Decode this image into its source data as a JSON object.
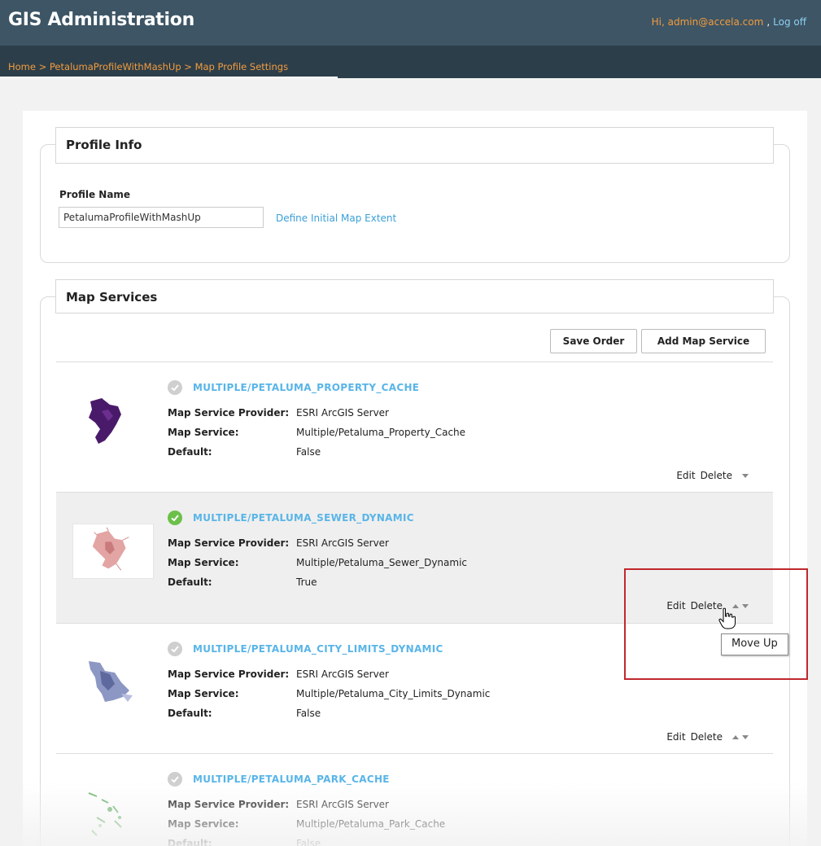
{
  "app": {
    "title": "GIS Administration"
  },
  "user": {
    "greeting": "Hi, admin@accela.com",
    "separator": ",",
    "logoff": "Log off"
  },
  "breadcrumb": "Home > PetalumaProfileWithMashUp > Map Profile Settings",
  "profile_info": {
    "heading": "Profile Info",
    "name_label": "Profile Name",
    "name_value": "PetalumaProfileWithMashUp",
    "extent_link": "Define Initial Map Extent"
  },
  "map_services": {
    "heading": "Map Services",
    "save_order": "Save Order",
    "add_service": "Add Map Service",
    "labels": {
      "provider": "Map Service Provider:",
      "service": "Map Service:",
      "default": "Default:"
    },
    "actions": {
      "edit": "Edit",
      "delete": "Delete"
    },
    "items": [
      {
        "name": "MULTIPLE/PETALUMA_PROPERTY_CACHE",
        "provider": "ESRI ArcGIS Server",
        "service": "Multiple/Petaluma_Property_Cache",
        "default": "False",
        "active": false,
        "thumb_color": "#4a1a6a"
      },
      {
        "name": "MULTIPLE/PETALUMA_SEWER_DYNAMIC",
        "provider": "ESRI ArcGIS Server",
        "service": "Multiple/Petaluma_Sewer_Dynamic",
        "default": "True",
        "active": true,
        "thumb_color": "#d08a8a"
      },
      {
        "name": "MULTIPLE/PETALUMA_CITY_LIMITS_DYNAMIC",
        "provider": "ESRI ArcGIS Server",
        "service": "Multiple/Petaluma_City_Limits_Dynamic",
        "default": "False",
        "active": false,
        "thumb_color": "#7a86b8"
      },
      {
        "name": "MULTIPLE/PETALUMA_PARK_CACHE",
        "provider": "ESRI ArcGIS Server",
        "service": "Multiple/Petaluma_Park_Cache",
        "default": "False",
        "active": false,
        "thumb_color": "#6fb56f"
      }
    ]
  },
  "tooltip": "Move Up",
  "colors": {
    "header": "#3d5565",
    "crumbbar": "#2c3e4a",
    "accent_orange": "#f39c3d",
    "link_blue": "#3aa0d8",
    "active_green": "#6cc04a",
    "highlight_box": "#c0282d"
  }
}
